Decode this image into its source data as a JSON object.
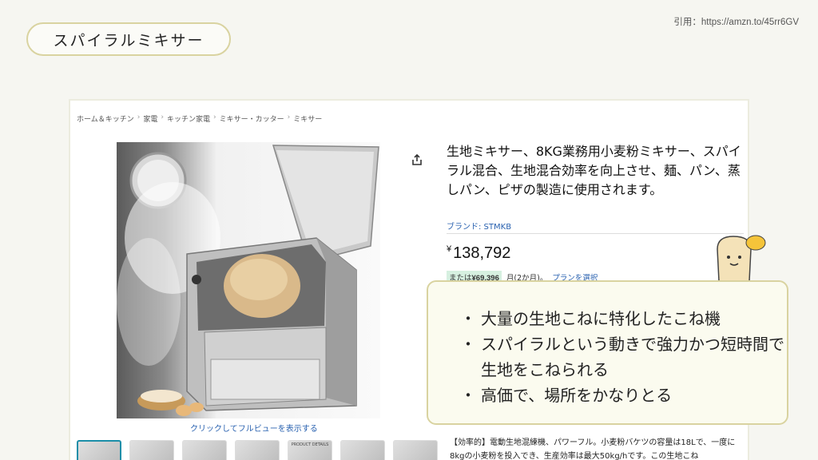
{
  "slide": {
    "title": "スパイラルミキサー",
    "source": "引用：https://amzn.to/45rr6GV"
  },
  "amazon": {
    "breadcrumb": [
      "ホーム＆キッチン",
      "家電",
      "キッチン家電",
      "ミキサー・カッター",
      "ミキサー"
    ],
    "breadcrumb_sep": "›",
    "product_title": "生地ミキサー、8KG業務用小麦粉ミキサー、スパイラル混合、生地混合効率を向上させ、麺、パン、蒸しパン、ピザの製造に使用されます。",
    "brand": "ブランド: STMKB",
    "price_symbol": "¥",
    "price": "138,792",
    "installment_prefix": "または",
    "installment_amount": "¥69,396",
    "installment_suffix": "月(2か月)。",
    "plan_link": "プランを選択",
    "fullview_link": "クリックしてフルビューを表示する",
    "thumbnail_label": "PRODUCT DETAILS",
    "description": "【効率的】電動生地混練機、パワーフル。小麦粉バケツの容量は18Lで、一度に8kgの小麦粉を投入でき、生産効率は最大50kg/hです。この生地こね"
  },
  "callout": {
    "bullets": [
      "大量の生地こねに特化したこね機",
      "スパイラルという動きで強力かつ短時間で生地をこねられる",
      "高価で、場所をかなりとる"
    ]
  },
  "colors": {
    "pill_border": "#d9d3a0",
    "link": "#2a62b0",
    "thumb_active": "#1b8ea8",
    "installment_bg": "#d6f0e0"
  }
}
